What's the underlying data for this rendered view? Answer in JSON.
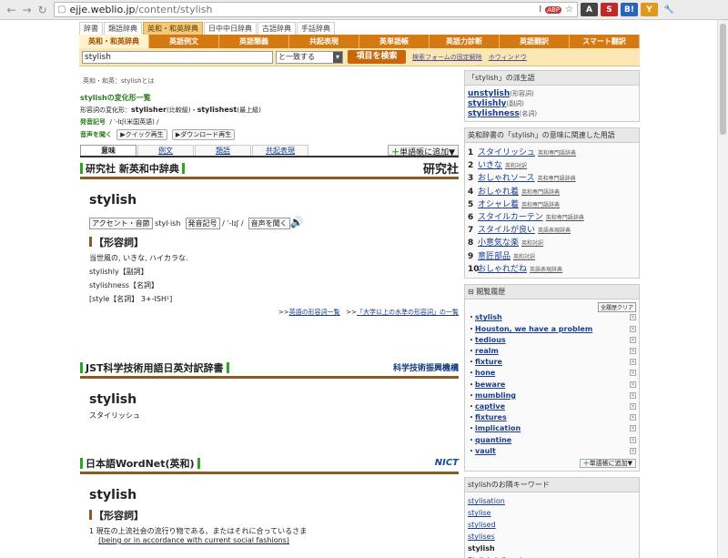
{
  "browser": {
    "url_host": "ejje.weblio.jp",
    "url_path": "/content/stylish",
    "ext": [
      "I",
      "☆",
      "ABP",
      "A",
      "S",
      "B!",
      "Y",
      "🔧"
    ]
  },
  "nav": {
    "tabs": [
      "辞書",
      "類語辞典",
      "英和・和英辞典",
      "日中中日辞典",
      "古語辞典",
      "手話辞典"
    ],
    "bar": [
      "英和・和英辞典",
      "英語例文",
      "英語類義",
      "共起表現",
      "英単語帳",
      "英語力診断",
      "英語翻訳",
      "スマート翻訳"
    ]
  },
  "search": {
    "value": "stylish",
    "mode": "と一致する",
    "button": "項目を検索",
    "link1": "検索フォームの固定解除",
    "link2": "ホウィンドウ"
  },
  "breadcrumb": "英和・和英：stylishとは",
  "inflection": {
    "title": "stylishの変化形一覧",
    "label": "形容詞の変化形：",
    "comp": "stylisher",
    "comp_n": "(比較級)",
    "sup": "stylishest",
    "sup_n": "(最上級)",
    "pron_label": "発音記号",
    "pron": "/ ˈ-lɪʃ",
    "pron_n": "(米国英語) /",
    "voice_label": "音声を聞く",
    "quick": "クイック再生",
    "dl": "ダウンロード再生"
  },
  "ctabs": [
    "意味",
    "例文",
    "類語",
    "共起表現"
  ],
  "addword": "単語帳に追加▼",
  "d1": {
    "title": "研究社 新英和中辞典",
    "logo": "研究社",
    "hw": "stylish",
    "accent": "アクセント・音節",
    "syl": "styl·ish",
    "pronl": "発音記号",
    "pron": "/ ˈ-lɪʃ /",
    "voice": "音声を聞く",
    "pos": "【形容詞】",
    "m1": "当世風の, いきな, ハイカラな.",
    "m2": "stylishly【副詞】",
    "m3": "stylishness【名詞】",
    "m4": "[style【名詞】 3+-ISH¹]",
    "l1": "英語の形容詞一覧",
    "l2": "「大学以上の水準の形容詞」の一覧"
  },
  "d2": {
    "title": "JST科学技術用語日英対訳辞書",
    "logo": "科学技術振興機構",
    "hw": "stylish",
    "m1": "スタイリッシュ"
  },
  "d3": {
    "title": "日本語WordNet(英和)",
    "logo": "NICT",
    "hw": "stylish",
    "pos": "【形容詞】",
    "m1": "1  現在の上流社会の流行り物である、またはそれに合っているさま",
    "m2": "(being or in accordance with current social fashions)"
  },
  "side": {
    "deriv_h": "「stylish」の派生語",
    "deriv": [
      {
        "w": "unstylish",
        "n": "(形容詞)"
      },
      {
        "w": "stylishly",
        "n": "(副詞)"
      },
      {
        "w": "stylishness",
        "n": "(名詞)"
      }
    ],
    "rel_h": "英和辞書の「stylish」の意味に関連した用語",
    "rel": [
      {
        "n": "1",
        "w": "スタイリッシュ",
        "s": "英和専門語辞典"
      },
      {
        "n": "2",
        "w": "いきな",
        "s": "英和対訳"
      },
      {
        "n": "3",
        "w": "おしゃれソース",
        "s": "英和専門語辞典"
      },
      {
        "n": "4",
        "w": "おしゃれ着",
        "s": "英和専門語辞典"
      },
      {
        "n": "5",
        "w": "オシャレ着",
        "s": "英和専門語辞典"
      },
      {
        "n": "6",
        "w": "スタイルカーテン",
        "s": "英和専門語辞典"
      },
      {
        "n": "7",
        "w": "スタイルが良い",
        "s": "英語表現辞典"
      },
      {
        "n": "8",
        "w": "小意気な楽",
        "s": "英和対訳"
      },
      {
        "n": "9",
        "w": "意匠部品",
        "s": "英和対訳"
      },
      {
        "n": "10",
        "w": "おしゃれだね",
        "s": "英語表現辞典"
      }
    ],
    "hist_h": "閲覧履歴",
    "hist_clear": "全履歴クリア",
    "hist": [
      "stylish",
      "Houston, we have a problem",
      "tedious",
      "realm",
      "fixture",
      "hone",
      "beware",
      "mumbling",
      "captive",
      "fixtures",
      "implication",
      "quantine",
      "vault"
    ],
    "hist_add": "単語帳に追加▼",
    "near_h": "stylishのお隣キーワード",
    "near": [
      "stylisation",
      "stylise",
      "stylised",
      "stylises",
      "stylish",
      "Stylish (album)"
    ]
  }
}
